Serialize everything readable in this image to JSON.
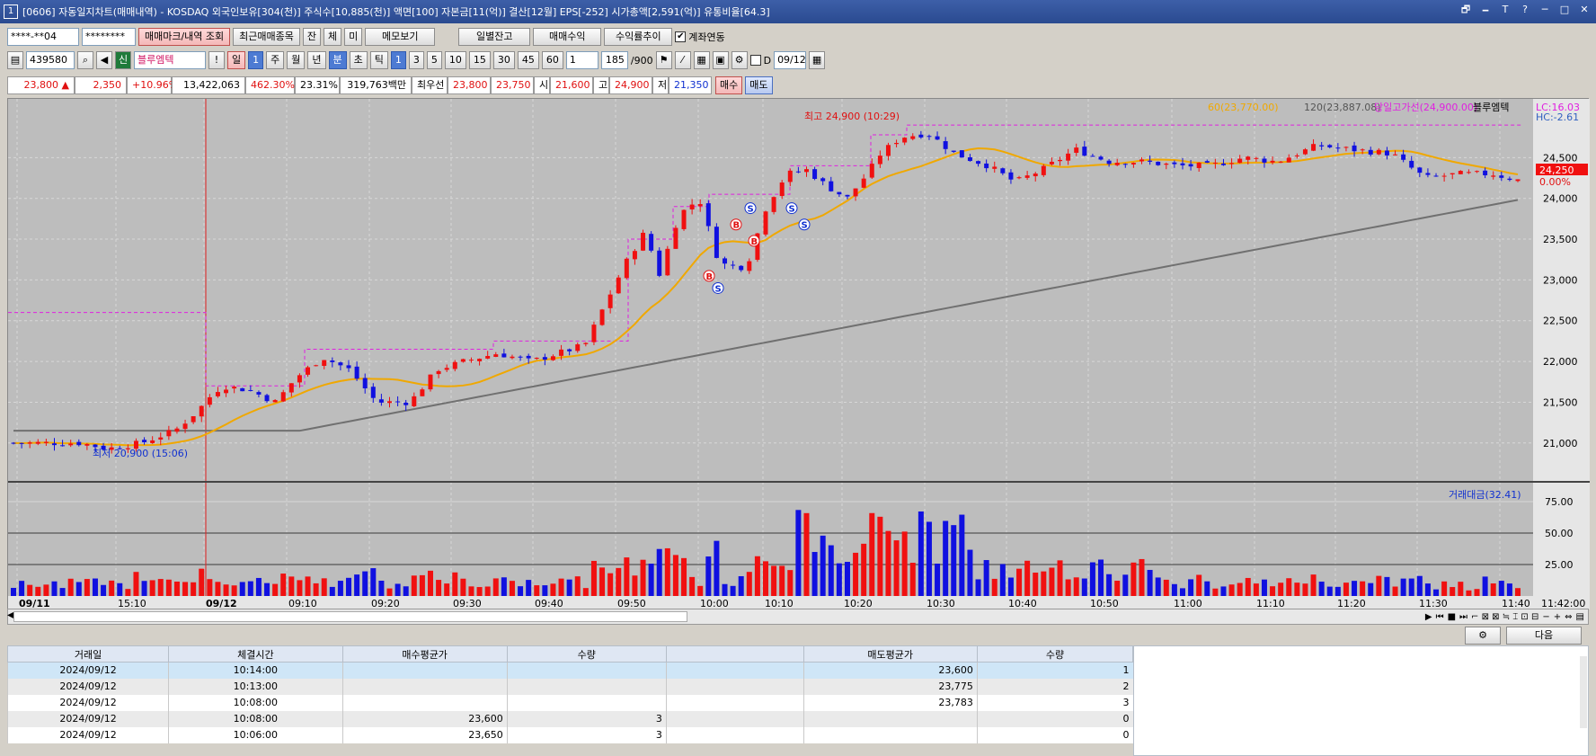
{
  "window": {
    "number": "1",
    "title": "[0606] 자동일지차트(매매내역) - KOSDAQ 외국인보유[304(천)] 주식수[10,885(천)] 액면[100] 자본금[11(억)] 결산[12월] EPS[-252] 시가총액[2,591(억)] 유통비율[64.3]",
    "controls": [
      "🗗",
      "🗕",
      "T",
      "?",
      "─",
      "□",
      "✕"
    ]
  },
  "toolbar1": {
    "account": "****-**04",
    "password": "********",
    "btn_trademark": "매매마크/내역 조회",
    "btn_recent": "최근매매종목",
    "btn_jan": "잔",
    "btn_che": "체",
    "btn_mi": "미",
    "btn_memo": "메모보기",
    "btn_daily": "일별잔고",
    "btn_profit": "매매수익",
    "btn_rate": "수익률추이",
    "account_link_label": "계좌연동",
    "account_link_checked": "✔"
  },
  "toolbar2": {
    "code": "439580",
    "shin": "신",
    "stock_name": "블루엠텍",
    "excl": "!",
    "periods": [
      "일",
      "1",
      "주",
      "월",
      "년",
      "분",
      "초",
      "틱"
    ],
    "period_nums": [
      "1",
      "3",
      "5",
      "10",
      "15",
      "30",
      "45",
      "60"
    ],
    "step": "1",
    "count": "185",
    "count_total": "/900",
    "d_label": "D",
    "date": "09/12"
  },
  "quote": {
    "price": "23,800 ▲",
    "change": "2,350",
    "rate": "+10.96%",
    "volume": "13,422,063",
    "vol_rate": "462.30%",
    "turnover": "23.31%",
    "amount": "319,763백만",
    "best_label": "최우선",
    "best_ask": "23,800",
    "best_bid": "23,750",
    "open_label": "시",
    "open": "21,600",
    "high_label": "고",
    "high": "24,900",
    "low_label": "저",
    "low": "21,350",
    "buy": "매수",
    "sell": "매도"
  },
  "chart": {
    "legend": {
      "ma60": "60(23,770.00)",
      "ma120": "120(23,887.08)",
      "highline": "당일고가선(24,900.00)",
      "name": "블루엠텍",
      "lc": "LC:16.03",
      "hc": "HC:-2.61"
    },
    "annotations": {
      "high": "최고 24,900 (10:29)",
      "low": "최저 20,900 (15:06)",
      "current": "24,250",
      "current_pct": "0.00%"
    },
    "price_ticks": [
      "24,500",
      "24,000",
      "23,500",
      "23,000",
      "22,500",
      "22,000",
      "21,500",
      "21,000"
    ],
    "vol_label": "거래대금(32.41)",
    "vol_ticks": [
      "75.00",
      "50.00",
      "25.00"
    ],
    "time_labels": [
      "09/11",
      "15:10",
      "09/12",
      "09:10",
      "09:20",
      "09:30",
      "09:40",
      "09:50",
      "10:00",
      "10:10",
      "10:20",
      "10:30",
      "10:40",
      "10:50",
      "11:00",
      "11:10",
      "11:20",
      "11:30",
      "11:40"
    ],
    "time_end": "11:42:00",
    "colors": {
      "up": "#f01010",
      "down": "#1010e0",
      "ma_short": "#f0a800",
      "ma_long": "#707070",
      "highline": "#e020e0"
    }
  },
  "chart_data": {
    "type": "candlestick",
    "title": "블루엠텍",
    "ylim": [
      20700,
      25000
    ],
    "ma": [
      "60",
      "120"
    ],
    "day_high": 24900,
    "day_low": 20900,
    "current": 24250
  },
  "bottom": {
    "next": "다음"
  },
  "table": {
    "headers": [
      "거래일",
      "체결시간",
      "매수평균가",
      "수량",
      "",
      "매도평균가",
      "수량"
    ],
    "rows": [
      [
        "2024/09/12",
        "10:14:00",
        "",
        "",
        "",
        "23,600",
        "1"
      ],
      [
        "2024/09/12",
        "10:13:00",
        "",
        "",
        "",
        "23,775",
        "2"
      ],
      [
        "2024/09/12",
        "10:08:00",
        "",
        "",
        "",
        "23,783",
        "3"
      ],
      [
        "2024/09/12",
        "10:08:00",
        "23,600",
        "3",
        "",
        "",
        "0"
      ],
      [
        "2024/09/12",
        "10:06:00",
        "23,650",
        "3",
        "",
        "",
        "0"
      ]
    ]
  }
}
